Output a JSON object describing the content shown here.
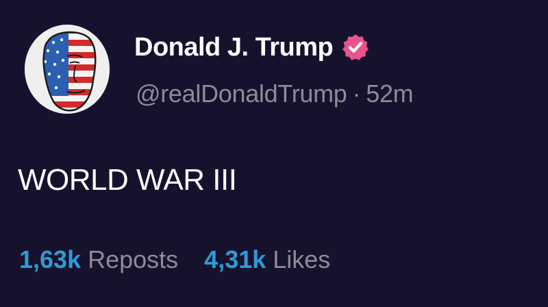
{
  "post": {
    "author": {
      "display_name": "Donald J. Trump",
      "handle": "@realDonaldTrump",
      "separator": "·",
      "time": "52m",
      "avatar_icon": "flag-portrait-avatar",
      "verified_icon": "verified-badge-icon",
      "verified_color": "#e8548a"
    },
    "text": "WORLD WAR III",
    "stats": {
      "reposts_count": "1,63k",
      "reposts_label": "Reposts",
      "likes_count": "4,31k",
      "likes_label": "Likes"
    }
  },
  "colors": {
    "background": "#16122e",
    "primary_text": "#ffffff",
    "secondary_text": "#8a8d96",
    "accent": "#2f9ad6"
  }
}
